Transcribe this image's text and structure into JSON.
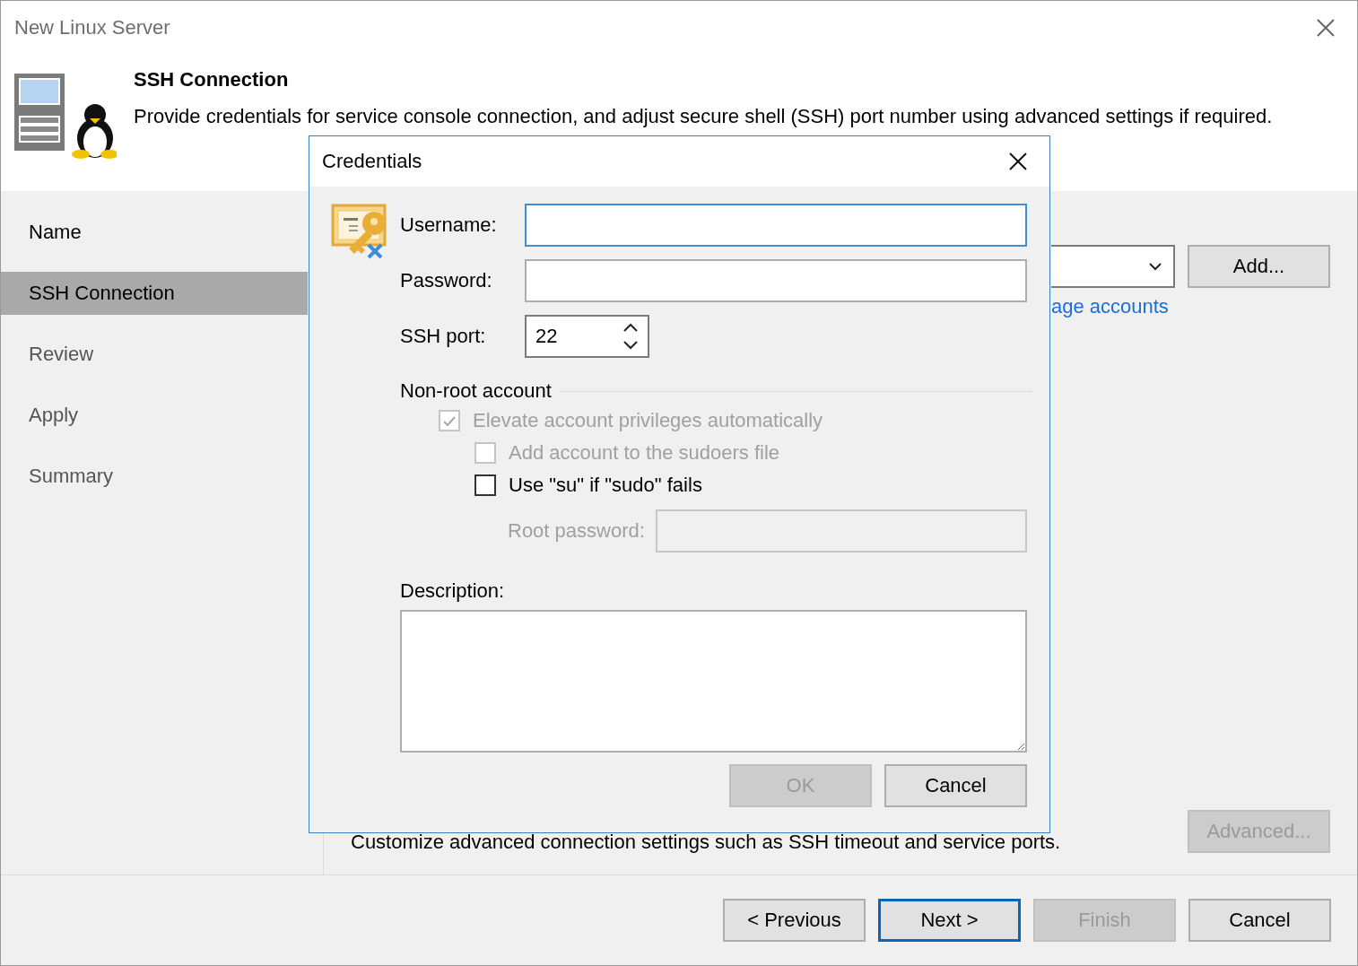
{
  "window": {
    "title": "New Linux Server"
  },
  "header": {
    "title": "SSH Connection",
    "description": "Provide credentials for service console connection, and adjust secure shell (SSH) port number using advanced settings if required."
  },
  "steps": [
    {
      "label": "Name",
      "selected": false,
      "disabled": false
    },
    {
      "label": "SSH Connection",
      "selected": true,
      "disabled": false
    },
    {
      "label": "Review",
      "selected": false,
      "disabled": true
    },
    {
      "label": "Apply",
      "selected": false,
      "disabled": true
    },
    {
      "label": "Summary",
      "selected": false,
      "disabled": true
    }
  ],
  "main": {
    "add_button": {
      "label": "Add...",
      "disabled": false
    },
    "link": "age accounts",
    "advanced_text": "Customize advanced connection settings such as SSH timeout and service ports.",
    "advanced_button": {
      "label": "Advanced...",
      "disabled": true
    }
  },
  "footer_buttons": [
    {
      "label": "< Previous",
      "disabled": false,
      "default": false
    },
    {
      "label": "Next >",
      "disabled": false,
      "default": true
    },
    {
      "label": "Finish",
      "disabled": true,
      "default": false
    },
    {
      "label": "Cancel",
      "disabled": false,
      "default": false
    }
  ],
  "dialog": {
    "title": "Credentials",
    "fields": [
      {
        "label": "Username:",
        "focused": true
      },
      {
        "label": "Password:",
        "focused": false
      }
    ],
    "ssh_port": {
      "label": "SSH port:",
      "value": "22"
    },
    "section": "Non-root account",
    "checkboxes": [
      {
        "label": "Elevate account privileges automatically",
        "checked": true,
        "disabled": true,
        "children": [
          {
            "label": "Add account to the sudoers file",
            "checked": false,
            "disabled": true
          },
          {
            "label": "Use \"su\" if \"sudo\" fails",
            "checked": false,
            "disabled": false
          }
        ]
      }
    ],
    "root_password": {
      "label": "Root password:",
      "disabled": true
    },
    "description_label": "Description:",
    "buttons": [
      {
        "label": "OK",
        "disabled": true
      },
      {
        "label": "Cancel",
        "disabled": false
      }
    ]
  }
}
